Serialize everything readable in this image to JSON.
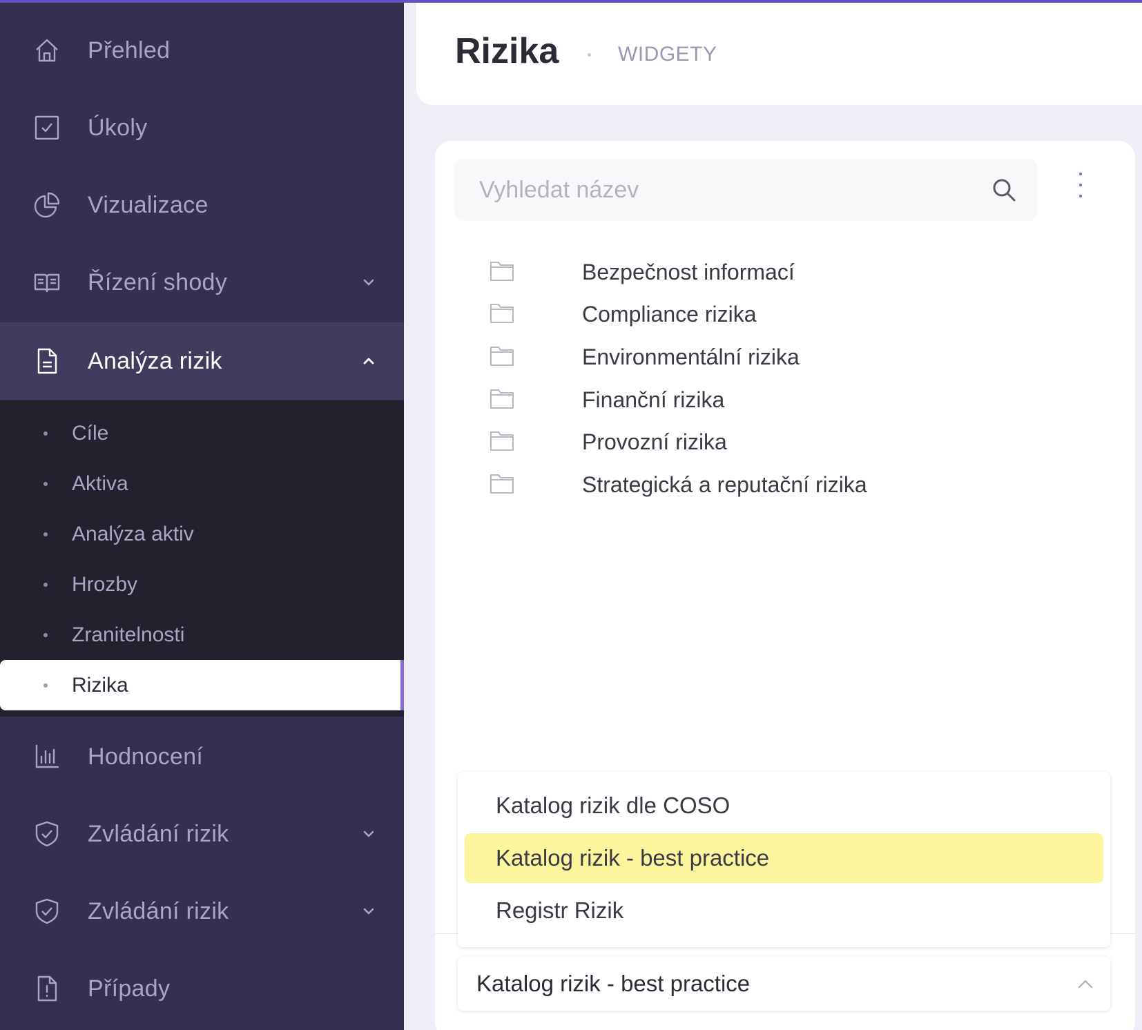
{
  "colors": {
    "sidebar_bg": "#36304f",
    "submenu_bg": "#22222f",
    "accent": "#6a4fc4",
    "highlight": "#fbf59e"
  },
  "sidebar": {
    "items": [
      {
        "label": "Přehled",
        "icon": "home-icon"
      },
      {
        "label": "Úkoly",
        "icon": "checkbox-icon"
      },
      {
        "label": "Vizualizace",
        "icon": "pie-chart-icon"
      },
      {
        "label": "Řízení shody",
        "icon": "book-icon",
        "chevron": "down"
      },
      {
        "label": "Analýza rizik",
        "icon": "document-icon",
        "chevron": "up",
        "expanded": true
      },
      {
        "label": "Hodnocení",
        "icon": "bar-chart-icon"
      },
      {
        "label": "Zvládání rizik",
        "icon": "shield-check-icon",
        "chevron": "down"
      },
      {
        "label": "Zvládání rizik",
        "icon": "shield-check-icon",
        "chevron": "down"
      },
      {
        "label": "Případy",
        "icon": "document-alert-icon"
      }
    ],
    "submenu": [
      {
        "label": "Cíle"
      },
      {
        "label": "Aktiva"
      },
      {
        "label": "Analýza aktiv"
      },
      {
        "label": "Hrozby"
      },
      {
        "label": "Zranitelnosti"
      },
      {
        "label": "Rizika",
        "active": true
      }
    ]
  },
  "header": {
    "title": "Rizika",
    "subtitle": "WIDGETY"
  },
  "search": {
    "placeholder": "Vyhledat název"
  },
  "folders": [
    {
      "label": "Bezpečnost informací"
    },
    {
      "label": "Compliance rizika"
    },
    {
      "label": "Environmentální rizika"
    },
    {
      "label": "Finanční rizika"
    },
    {
      "label": "Provozní rizika"
    },
    {
      "label": "Strategická a reputační rizika"
    }
  ],
  "catalog_select": {
    "options": [
      {
        "label": "Katalog rizik dle COSO"
      },
      {
        "label": "Katalog rizik - best practice",
        "selected": true
      },
      {
        "label": "Registr Rizik"
      }
    ],
    "value": "Katalog rizik - best practice"
  }
}
